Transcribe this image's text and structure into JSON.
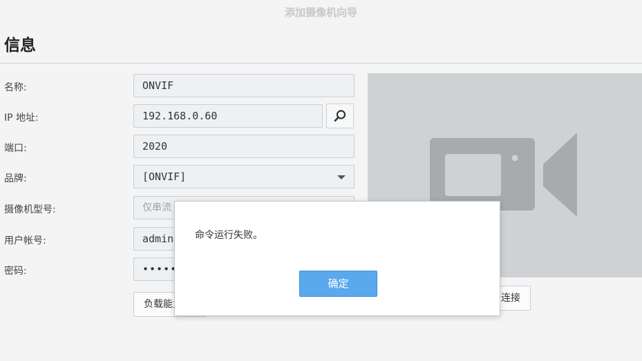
{
  "wizard": {
    "title": "添加摄像机向导"
  },
  "section": {
    "title": "信息"
  },
  "form": {
    "name": {
      "label": "名称:",
      "value": "ONVIF"
    },
    "ip": {
      "label": "IP 地址:",
      "value": "192.168.0.60"
    },
    "port": {
      "label": "端口:",
      "value": "2020"
    },
    "brand": {
      "label": "品牌:",
      "value": "[ONVIF]"
    },
    "model": {
      "label": "摄像机型号:",
      "value": "仅串流"
    },
    "username": {
      "label": "用户帐号:",
      "value": "admin"
    },
    "password": {
      "label": "密码:",
      "value": "•••••"
    }
  },
  "buttons": {
    "load": "负载能力",
    "test_connection": "连接"
  },
  "dialog": {
    "message": "命令运行失败。",
    "ok": "确定"
  },
  "colors": {
    "accent": "#5aa8ee",
    "preview_bg": "#cfd2d4",
    "camera_icon": "#a7abae"
  }
}
